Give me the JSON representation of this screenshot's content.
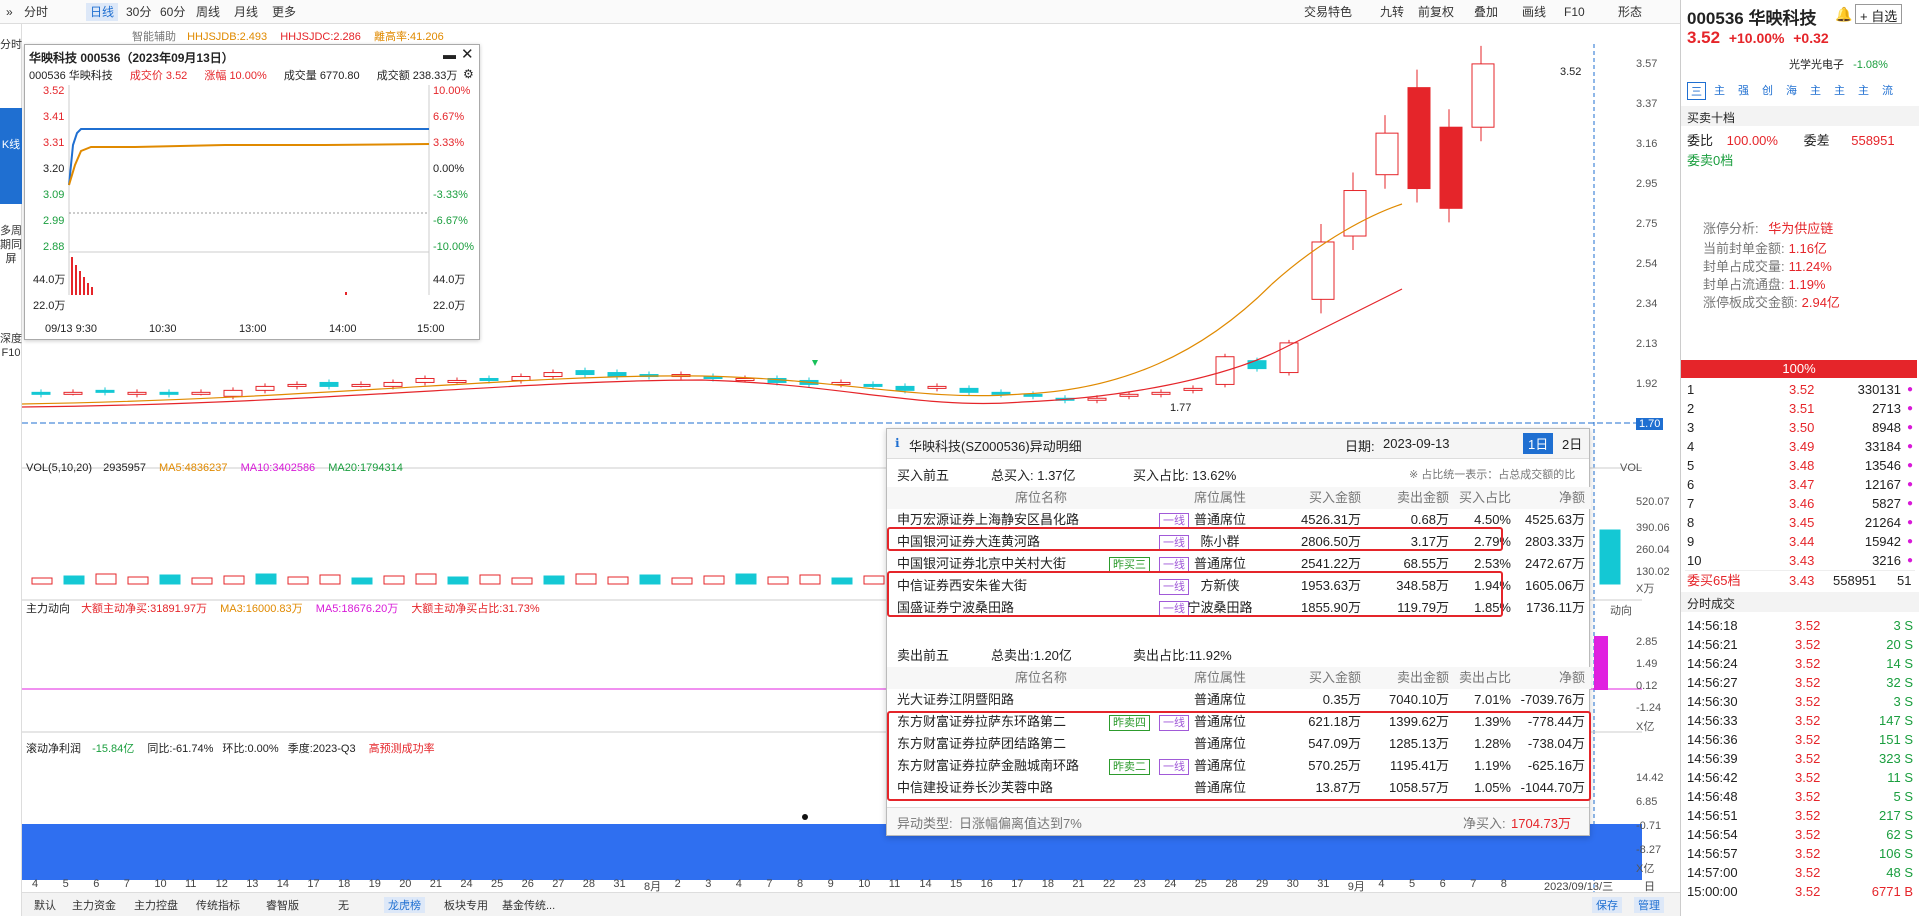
{
  "toolbar": {
    "expand": "»",
    "items": [
      "分时",
      "日线",
      "30分",
      "60分",
      "周线",
      "月线",
      "更多"
    ],
    "right": [
      "交易特色",
      "九转",
      "前复权",
      "叠加",
      "画线",
      "F10",
      "形态"
    ]
  },
  "leftnav": [
    "分时",
    "K线",
    "多周期同屏",
    "深度F10"
  ],
  "indicators": {
    "main": "智能辅助",
    "hhjsjdb": "HHJSJDB:2.493",
    "hhjsjdc": "HHJSJDC:2.286",
    "away": "離高率:41.206"
  },
  "popup": {
    "title": "华映科技 000536（2023年09月13日）",
    "code": "000536 华映科技",
    "price_label": "成交价",
    "price": "3.52",
    "chg_label": "涨幅",
    "chg": "10.00%",
    "vol_label": "成交量",
    "vol": "6770.80",
    "amt_label": "成交额",
    "amt": "238.33万",
    "ylabels": [
      "3.52",
      "3.41",
      "3.31",
      "3.20",
      "3.09",
      "2.99",
      "2.88"
    ],
    "rlabels": [
      "10.00%",
      "6.67%",
      "3.33%",
      "0.00%",
      "-3.33%",
      "-6.67%",
      "-10.00%"
    ],
    "vlabels": [
      "44.0万",
      "22.0万"
    ],
    "times": [
      "09/13 9:30",
      "10:30",
      "13:00",
      "14:00",
      "15:00"
    ]
  },
  "vol": {
    "label": "VOL(5,10,20)",
    "v": "2935957",
    "ma5": "MA5:4836237",
    "ma10": "MA10:3402586",
    "ma20": "MA20:1794314"
  },
  "zhuli": {
    "label": "主力动向",
    "a": "大额主动净买:31891.97万",
    "b": "MA3:16000.83万",
    "c": "MA5:18676.20万",
    "d": "大额主动净买占比:31.73%"
  },
  "roll": {
    "label": "滚动净利润",
    "a": "-15.84亿",
    "b": "同比:-61.74%",
    "c": "环比:0.00%",
    "d": "季度:2023-Q3",
    "e": "高预测成功率"
  },
  "yaxis": {
    "price": [
      "3.57",
      "3.37",
      "3.16",
      "2.95",
      "2.75",
      "2.54",
      "2.34",
      "2.13",
      "1.92",
      "1.70"
    ],
    "vol": [
      "520.07",
      "390.06",
      "260.04",
      "130.02",
      "X万"
    ],
    "zl": [
      "2.85",
      "1.49",
      "0.12",
      "-1.24",
      "X亿"
    ],
    "rp": [
      "14.42",
      "6.85",
      "-0.71",
      "-8.27",
      "X亿"
    ],
    "hi": "3.52",
    "lo": "1.77",
    "vollabel": "VOL",
    "zllabel": "动向"
  },
  "xaxis": [
    "4",
    "5",
    "6",
    "7",
    "10",
    "11",
    "12",
    "13",
    "14",
    "17",
    "18",
    "19",
    "20",
    "21",
    "24",
    "25",
    "26",
    "27",
    "28",
    "31",
    "8月",
    "2",
    "3",
    "4",
    "7",
    "8",
    "9",
    "10",
    "11",
    "14",
    "15",
    "16",
    "17",
    "18",
    "21",
    "22",
    "23",
    "24",
    "25",
    "28",
    "29",
    "30",
    "31",
    "9月",
    "4",
    "5",
    "6",
    "7",
    "8",
    "2023/09/13/三",
    "日线"
  ],
  "bottom": [
    "默认",
    "主力资金",
    "主力控盘",
    "传统指标",
    "睿智版",
    "无",
    "龙虎榜",
    "板块专用",
    "基金传统...",
    "保存",
    "管理"
  ],
  "detail": {
    "title": "华映科技(SZ000536)异动明细",
    "date_label": "日期:",
    "date": "2023-09-13",
    "d1": "1日",
    "d2": "2日",
    "buy_title": "买入前五",
    "buy_total": "总买入: 1.37亿",
    "buy_pct": "买入占比: 13.62%",
    "note": "※ 占比统一表示：占总成交额的比",
    "headers": [
      "席位名称",
      "席位属性",
      "买入金额",
      "卖出金额",
      "买入占比",
      "净额"
    ],
    "buy": [
      {
        "name": "申万宏源证券上海静安区昌化路",
        "tagA": "",
        "tagB": "一线",
        "attr": "普通席位",
        "buy": "4526.31万",
        "sell": "0.68万",
        "pct": "4.50%",
        "net": "4525.63万"
      },
      {
        "name": "中国银河证券大连黄河路",
        "tagA": "",
        "tagB": "一线",
        "attr": "陈小群",
        "buy": "2806.50万",
        "sell": "3.17万",
        "pct": "2.79%",
        "net": "2803.33万"
      },
      {
        "name": "中国银河证券北京中关村大街",
        "tagA": "昨买三",
        "tagB": "一线",
        "attr": "普通席位",
        "buy": "2541.22万",
        "sell": "68.55万",
        "pct": "2.53%",
        "net": "2472.67万"
      },
      {
        "name": "中信证券西安朱雀大街",
        "tagA": "",
        "tagB": "一线",
        "attr": "方新侠",
        "buy": "1953.63万",
        "sell": "348.58万",
        "pct": "1.94%",
        "net": "1605.06万"
      },
      {
        "name": "国盛证券宁波桑田路",
        "tagA": "",
        "tagB": "一线",
        "attr": "宁波桑田路",
        "buy": "1855.90万",
        "sell": "119.79万",
        "pct": "1.85%",
        "net": "1736.11万"
      }
    ],
    "sell_title": "卖出前五",
    "sell_total": "总卖出:1.20亿",
    "sell_pct": "卖出占比:11.92%",
    "sheaders": [
      "席位名称",
      "席位属性",
      "买入金额",
      "卖出金额",
      "卖出占比",
      "净额"
    ],
    "sell": [
      {
        "name": "光大证券江阴暨阳路",
        "tagA": "",
        "tagB": "",
        "attr": "普通席位",
        "buy": "0.35万",
        "sell": "7040.10万",
        "pct": "7.01%",
        "net": "-7039.76万"
      },
      {
        "name": "东方财富证券拉萨东环路第二",
        "tagA": "昨卖四",
        "tagB": "一线",
        "attr": "普通席位",
        "buy": "621.18万",
        "sell": "1399.62万",
        "pct": "1.39%",
        "net": "-778.44万"
      },
      {
        "name": "东方财富证券拉萨团结路第二",
        "tagA": "",
        "tagB": "",
        "attr": "普通席位",
        "buy": "547.09万",
        "sell": "1285.13万",
        "pct": "1.28%",
        "net": "-738.04万"
      },
      {
        "name": "东方财富证券拉萨金融城南环路",
        "tagA": "昨卖二",
        "tagB": "一线",
        "attr": "普通席位",
        "buy": "570.25万",
        "sell": "1195.41万",
        "pct": "1.19%",
        "net": "-625.16万"
      },
      {
        "name": "中信建投证券长沙芙蓉中路",
        "tagA": "",
        "tagB": "",
        "attr": "普通席位",
        "buy": "13.87万",
        "sell": "1058.57万",
        "pct": "1.05%",
        "net": "-1044.70万"
      }
    ],
    "type_label": "异动类型:",
    "type": "日涨幅偏离值达到7%",
    "net_label": "净买入:",
    "net": "1704.73万"
  },
  "right": {
    "code": "000536",
    "name": "华映科技",
    "add": "自选",
    "price": "3.52",
    "chg": "+10.00%",
    "chgv": "+0.32",
    "sector": "光学光电子",
    "sector_chg": "-1.08%",
    "tabs": [
      "三",
      "主",
      "强",
      "创",
      "海",
      "主",
      "主",
      "主",
      "流"
    ],
    "book_title": "买卖十档",
    "wb_label": "委比",
    "wb": "100.00%",
    "wc_label": "委差",
    "wc": "558951",
    "sell0": "委卖0档",
    "zt_a": "涨停分析:",
    "zt_b": "华为供应链",
    "zt_rows": [
      [
        "当前封单金额:",
        "1.16亿"
      ],
      [
        "封单占成交量:",
        "11.24%"
      ],
      [
        "封单占流通盘:",
        "1.19%"
      ],
      [
        "涨停板成交金额:",
        "2.94亿"
      ]
    ],
    "pct100": "100%",
    "bids": [
      [
        "1",
        "3.52",
        "330131"
      ],
      [
        "2",
        "3.51",
        "2713"
      ],
      [
        "3",
        "3.50",
        "8948"
      ],
      [
        "4",
        "3.49",
        "33184"
      ],
      [
        "5",
        "3.48",
        "13546"
      ],
      [
        "6",
        "3.47",
        "12167"
      ],
      [
        "7",
        "3.46",
        "5827"
      ],
      [
        "8",
        "3.45",
        "21264"
      ],
      [
        "9",
        "3.44",
        "15942"
      ],
      [
        "10",
        "3.43",
        "3216"
      ]
    ],
    "buy65": [
      "委买65档",
      "3.43",
      "558951",
      "51"
    ],
    "ticks_title": "分时成交",
    "ticks": [
      [
        "14:56:18",
        "3.52",
        "3 S"
      ],
      [
        "14:56:21",
        "3.52",
        "20 S"
      ],
      [
        "14:56:24",
        "3.52",
        "14 S"
      ],
      [
        "14:56:27",
        "3.52",
        "32 S"
      ],
      [
        "14:56:30",
        "3.52",
        "3 S"
      ],
      [
        "14:56:33",
        "3.52",
        "147 S"
      ],
      [
        "14:56:36",
        "3.52",
        "151 S"
      ],
      [
        "14:56:39",
        "3.52",
        "323 S"
      ],
      [
        "14:56:42",
        "3.52",
        "11 S"
      ],
      [
        "14:56:48",
        "3.52",
        "5 S"
      ],
      [
        "14:56:51",
        "3.52",
        "217 S"
      ],
      [
        "14:56:54",
        "3.52",
        "62 S"
      ],
      [
        "14:56:57",
        "3.52",
        "106 S"
      ],
      [
        "14:57:00",
        "3.52",
        "48 S"
      ],
      [
        "15:00:00",
        "3.52",
        "6771 B"
      ]
    ]
  },
  "colors": {
    "up": "#e5252a",
    "down": "#14c8d4",
    "accent": "#1f6fd1"
  },
  "chart_data": [
    {
      "type": "candlestick",
      "title": "华映科技 000536 日线",
      "ylim": [
        1.7,
        3.57
      ],
      "x_range": [
        "2023-07-04",
        "2023-09-13"
      ],
      "series": [
        {
          "name": "K线",
          "values": [
            {
              "date": "2023-09-05",
              "o": 2.33,
              "c": 2.62
            },
            {
              "date": "2023-09-06",
              "o": 2.65,
              "c": 2.88
            },
            {
              "date": "2023-09-07",
              "o": 2.96,
              "c": 3.17
            },
            {
              "date": "2023-09-08",
              "o": 3.4,
              "c": 2.89
            },
            {
              "date": "2023-09-11",
              "o": 3.2,
              "c": 2.79
            },
            {
              "date": "2023-09-13",
              "o": 3.2,
              "c": 3.52
            }
          ]
        }
      ]
    },
    {
      "type": "line",
      "title": "000536 华映科技 分时 2023-09-13",
      "x": [
        "9:30",
        "10:30",
        "13:00",
        "14:00",
        "15:00"
      ],
      "ylim": [
        2.88,
        3.52
      ],
      "series": [
        {
          "name": "price",
          "values": [
            3.2,
            3.52,
            3.52,
            3.52,
            3.52
          ]
        },
        {
          "name": "avg",
          "values": [
            3.2,
            3.4,
            3.41,
            3.42,
            3.42
          ]
        }
      ]
    }
  ]
}
